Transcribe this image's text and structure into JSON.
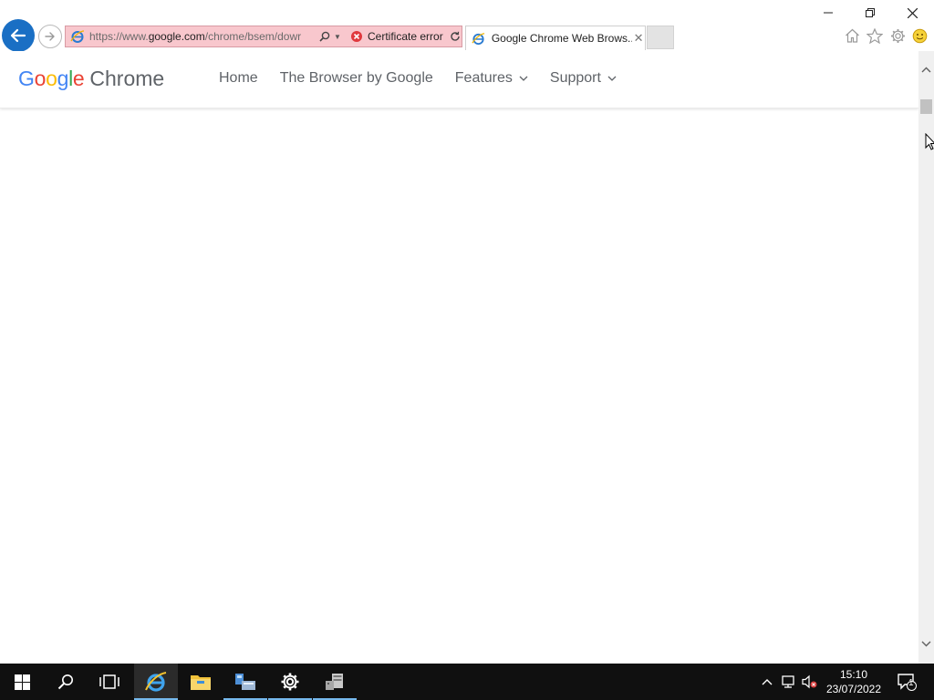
{
  "browser": {
    "address": {
      "url_prefix": "https://www.",
      "url_host": "google.com",
      "url_path": "/chrome/bsem/dowr",
      "cert_label": "Certificate error"
    },
    "tab": {
      "title": "Google Chrome Web Brows..."
    },
    "colors": {
      "address_error_bg": "#f8c7cd",
      "back_button": "#1a6fc4"
    }
  },
  "site": {
    "logo": {
      "letters": [
        "G",
        "o",
        "o",
        "g",
        "l",
        "e"
      ],
      "product": "Chrome"
    },
    "nav": {
      "home": "Home",
      "browser": "The Browser by Google",
      "features": "Features",
      "support": "Support"
    }
  },
  "taskbar": {
    "clock_time": "15:10",
    "clock_date": "23/07/2022",
    "notification_count": "1",
    "apps": [
      "start-icon",
      "search-icon",
      "task-view-icon",
      "internet-explorer-icon",
      "file-explorer-icon",
      "network-manager-icon",
      "settings-icon",
      "server-manager-icon"
    ]
  }
}
